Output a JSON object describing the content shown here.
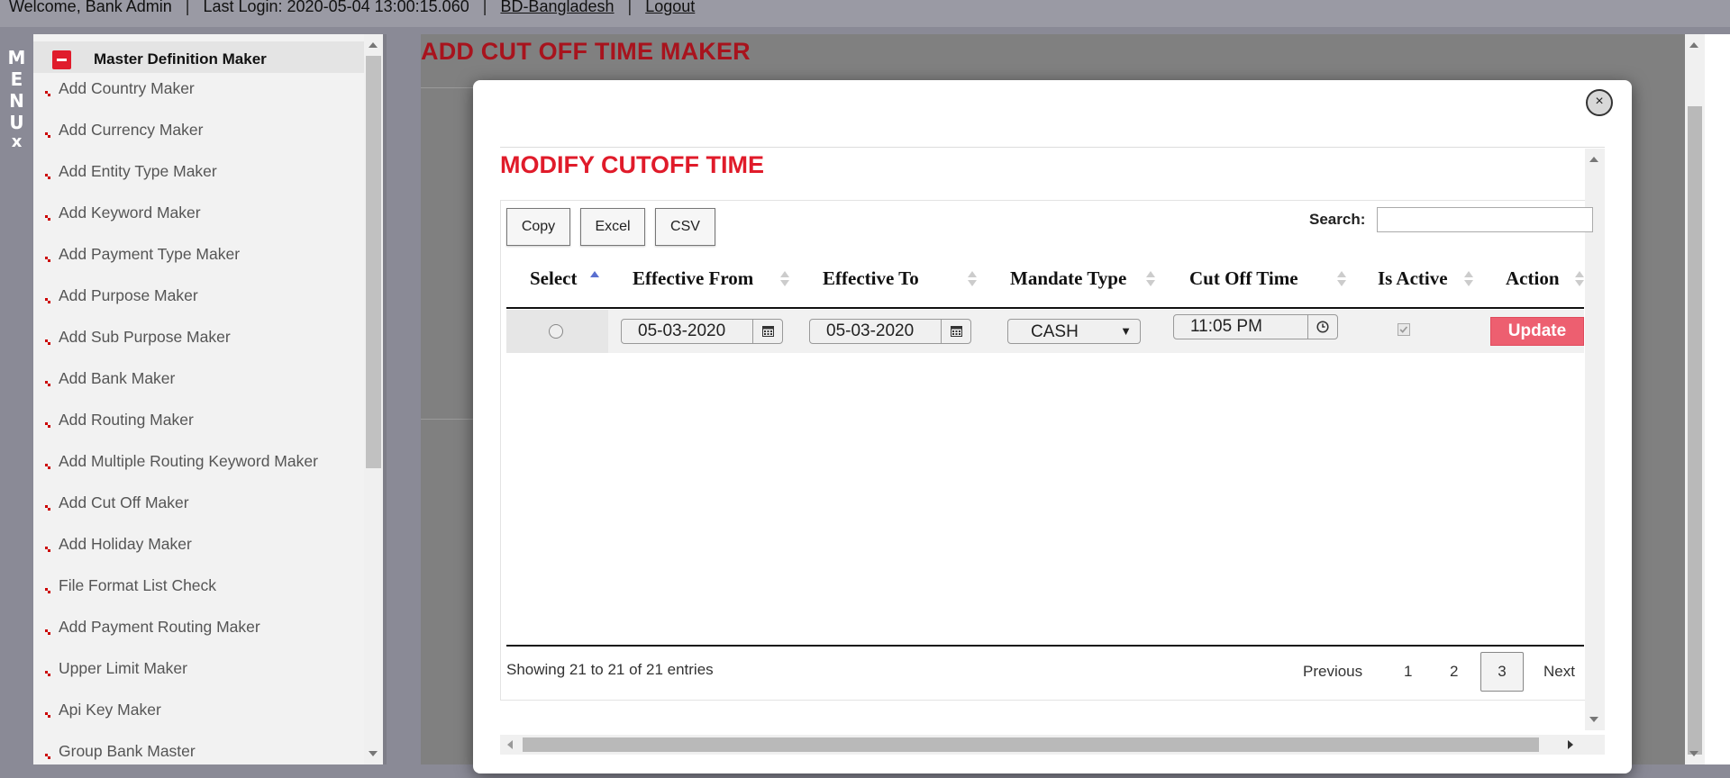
{
  "topbar": {
    "welcome": "Welcome, Bank Admin",
    "last_login": "Last Login: 2020-05-04 13:00:15.060",
    "region_link": "BD-Bangladesh",
    "logout_link": "Logout"
  },
  "menu_strip": {
    "letters": [
      "M",
      "E",
      "N",
      "U"
    ],
    "close": "x"
  },
  "sidebar": {
    "header": "Master Definition Maker",
    "items": [
      {
        "label": "Add Country Maker"
      },
      {
        "label": "Add Currency Maker"
      },
      {
        "label": "Add Entity Type Maker"
      },
      {
        "label": "Add Keyword Maker"
      },
      {
        "label": "Add Payment Type Maker"
      },
      {
        "label": "Add Purpose Maker"
      },
      {
        "label": "Add Sub Purpose Maker"
      },
      {
        "label": "Add Bank Maker"
      },
      {
        "label": "Add Routing Maker"
      },
      {
        "label": "Add Multiple Routing Keyword Maker"
      },
      {
        "label": "Add Cut Off Maker"
      },
      {
        "label": "Add Holiday Maker"
      },
      {
        "label": "File Format List Check"
      },
      {
        "label": "Add Payment Routing Maker"
      },
      {
        "label": "Upper Limit Maker"
      },
      {
        "label": "Api Key Maker"
      },
      {
        "label": "Group Bank Master"
      }
    ]
  },
  "page": {
    "title": "ADD CUT OFF TIME MAKER"
  },
  "modal": {
    "close": "×",
    "title": "MODIFY CUTOFF TIME",
    "buttons": {
      "copy": "Copy",
      "excel": "Excel",
      "csv": "CSV"
    },
    "search_label": "Search:",
    "search_value": "",
    "table": {
      "headers": [
        "Select",
        "Effective From",
        "Effective To",
        "Mandate Type",
        "Cut Off Time",
        "Is Active",
        "Action"
      ],
      "row": {
        "effective_from": "05-03-2020",
        "effective_to": "05-03-2020",
        "mandate_type": "CASH",
        "cut_off_time": "11:05 PM",
        "is_active": true,
        "action": "Update"
      }
    },
    "info": "Showing 21 to 21 of 21 entries",
    "pagination": {
      "previous": "Previous",
      "pages": [
        "1",
        "2",
        "3"
      ],
      "current": "3",
      "next": "Next"
    }
  },
  "colors": {
    "title_dark_red": "#a8131d",
    "modal_title_red": "#e01b2a",
    "update_button": "#ed5f70",
    "sort_active": "#5a6fd0"
  }
}
